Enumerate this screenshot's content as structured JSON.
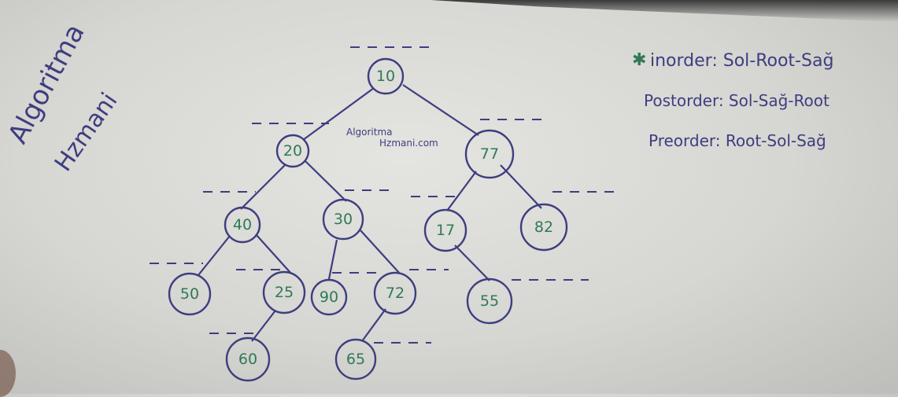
{
  "watermark": {
    "line1": "Algoritma",
    "line2": "Hzmani"
  },
  "tree_watermark": {
    "line1": "Algoritma",
    "line2": "Hzmani.com"
  },
  "tree": {
    "nodes": [
      "10",
      "20",
      "77",
      "40",
      "30",
      "17",
      "82",
      "50",
      "25",
      "90",
      "72",
      "55",
      "60",
      "65"
    ],
    "edges": [
      [
        "10",
        "20"
      ],
      [
        "10",
        "77"
      ],
      [
        "20",
        "40"
      ],
      [
        "20",
        "30"
      ],
      [
        "77",
        "17"
      ],
      [
        "77",
        "82"
      ],
      [
        "40",
        "50"
      ],
      [
        "40",
        "25"
      ],
      [
        "30",
        "90"
      ],
      [
        "30",
        "72"
      ],
      [
        "17",
        "55"
      ],
      [
        "25",
        "60"
      ],
      [
        "72",
        "65"
      ]
    ]
  },
  "notes": {
    "star_icon": "star-icon",
    "inorder": "inorder: Sol-Root-Sağ",
    "postorder": "Postorder: Sol-Sağ-Root",
    "preorder": "Preorder: Root-Sol-Sağ"
  },
  "colors": {
    "ink": "#3e3d80",
    "node_text": "#2f7a55",
    "star": "#2f7a55"
  }
}
